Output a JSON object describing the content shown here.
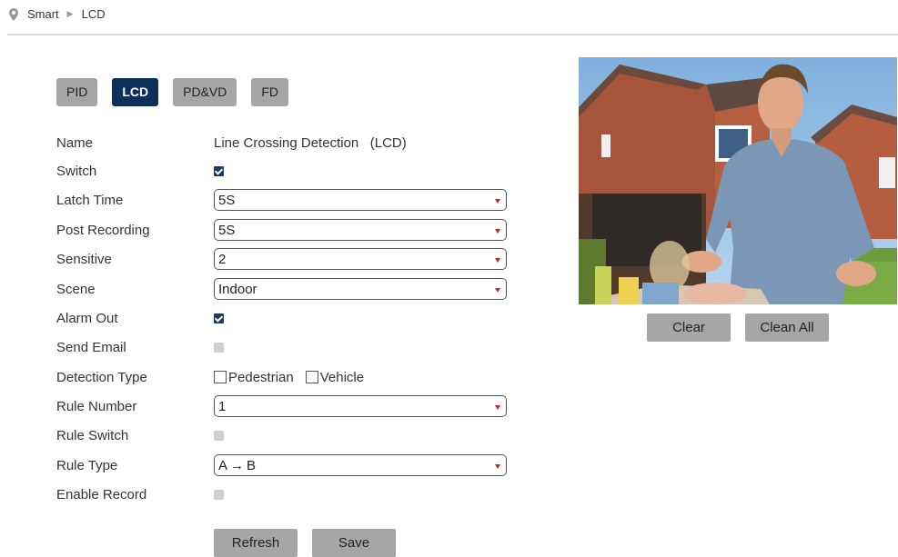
{
  "breadcrumb": {
    "root": "Smart",
    "current": "LCD"
  },
  "tabs": [
    {
      "label": "PID",
      "active": false
    },
    {
      "label": "LCD",
      "active": true
    },
    {
      "label": "PD&VD",
      "active": false
    },
    {
      "label": "FD",
      "active": false
    }
  ],
  "form": {
    "name": {
      "label": "Name",
      "value": "Line Crossing Detection   (LCD)"
    },
    "switch": {
      "label": "Switch",
      "checked": true
    },
    "latch_time": {
      "label": "Latch Time",
      "value": "5S"
    },
    "post_recording": {
      "label": "Post Recording",
      "value": "5S"
    },
    "sensitive": {
      "label": "Sensitive",
      "value": "2"
    },
    "scene": {
      "label": "Scene",
      "value": "Indoor"
    },
    "alarm_out": {
      "label": "Alarm Out",
      "checked": true
    },
    "send_email": {
      "label": "Send Email",
      "checked": false
    },
    "detection_type": {
      "label": "Detection Type",
      "pedestrian": "Pedestrian",
      "vehicle": "Vehicle"
    },
    "rule_number": {
      "label": "Rule Number",
      "value": "1"
    },
    "rule_switch": {
      "label": "Rule Switch",
      "checked": false
    },
    "rule_type": {
      "label": "Rule Type",
      "value": "A → B"
    },
    "enable_record": {
      "label": "Enable Record",
      "checked": false
    }
  },
  "buttons": {
    "refresh": "Refresh",
    "save": "Save",
    "clear": "Clear",
    "clean_all": "Clean All"
  },
  "colors": {
    "active_tab": "#0f2f5b",
    "button": "#a6a6a6",
    "caret": "#cc2222"
  }
}
